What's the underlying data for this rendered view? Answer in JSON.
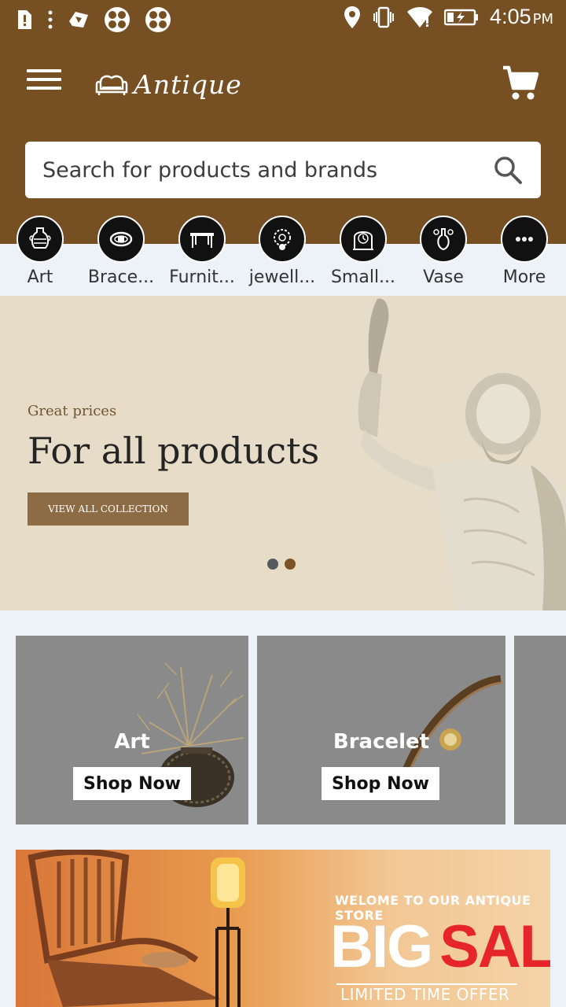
{
  "status_bar": {
    "time": "4:05",
    "ampm": "PM",
    "icons": [
      "sim-alert-icon",
      "more-vert-icon",
      "app-icon",
      "clover-icon",
      "clover-icon",
      "location-icon",
      "vibrate-icon",
      "wifi-icon",
      "battery-charging-icon"
    ]
  },
  "app_bar": {
    "brand": "Antique",
    "icons": [
      "menu-icon",
      "sofa-logo-icon",
      "cart-icon"
    ]
  },
  "search": {
    "placeholder": "Search for products and brands",
    "icon": "search-icon"
  },
  "categories": [
    {
      "label": "Art",
      "icon": "vase-icon"
    },
    {
      "label": "Brace...",
      "icon": "bracelet-icon"
    },
    {
      "label": "Furnit...",
      "icon": "table-icon"
    },
    {
      "label": "jewell...",
      "icon": "necklace-icon"
    },
    {
      "label": "Small...",
      "icon": "clock-icon"
    },
    {
      "label": "Vase",
      "icon": "vase-icon"
    },
    {
      "label": "More",
      "icon": "more-icon"
    }
  ],
  "hero": {
    "kicker": "Great prices",
    "title": "For all products",
    "button": "VIEW ALL COLLECTION",
    "slides": 2,
    "active_slide": 2
  },
  "tiles": [
    {
      "title": "Art",
      "button": "Shop Now"
    },
    {
      "title": "Bracelet",
      "button": "Shop Now"
    }
  ],
  "promo": {
    "welcome": "WELOME TO OUR ANTIQUE STORE",
    "big": "BIG",
    "sale": "SALE",
    "offer": "LIMITED TIME OFFER"
  },
  "colors": {
    "brand": "#764f23",
    "hero_bg": "#e6dcc8",
    "hero_button": "#8d6b44",
    "sale_red": "#e5252a",
    "tile_bg": "#8a8a8a"
  }
}
